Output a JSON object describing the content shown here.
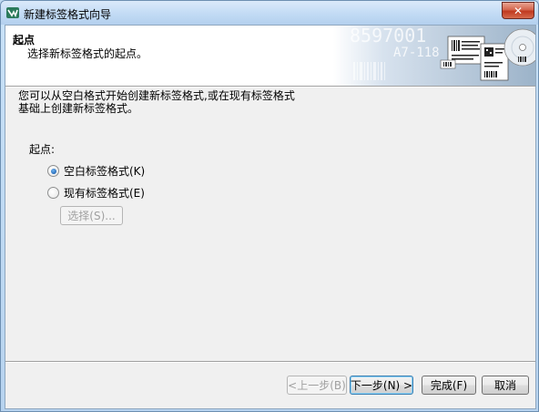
{
  "window": {
    "title": "新建标签格式向导",
    "close_label": "✕"
  },
  "header": {
    "title": "起点",
    "subtitle": "选择新标签格式的起点。",
    "banner_text": [
      "8597001",
      "A7-118"
    ]
  },
  "main": {
    "intro": "您可以从空白格式开始创建新标签格式,或在现有标签格式\n基础上创建新标签格式。",
    "group_label": "起点:",
    "options": [
      {
        "label": "空白标签格式(K)",
        "checked": true
      },
      {
        "label": "现有标签格式(E)",
        "checked": false
      }
    ],
    "select_button": "选择(S)..."
  },
  "footer": {
    "back_button": "<上一步(B)",
    "next_button": "下一步(N) >",
    "finish_button": "完成(F)",
    "cancel_button": "取消"
  },
  "colors": {
    "title_bar": "#c4dcf5",
    "dialog_bg": "#f0f0f0",
    "close_button": "#c0391f",
    "radio_checked": "#1a5fb0"
  },
  "icons": {
    "app": "label-wizard-icon",
    "close": "close-icon"
  }
}
